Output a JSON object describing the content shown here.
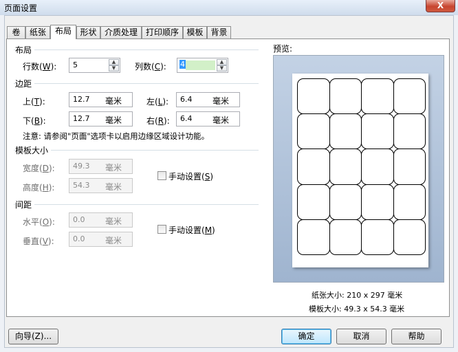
{
  "window": {
    "title": "页面设置",
    "close_label": "X"
  },
  "tabs": [
    "卷",
    "纸张",
    "布局",
    "形状",
    "介质处理",
    "打印顺序",
    "模板",
    "背景"
  ],
  "active_tab": "布局",
  "layout_section": {
    "title": "布局",
    "rows_label": "行数(",
    "rows_key": "W",
    "rows_close": "):",
    "rows_value": "5",
    "cols_label": "列数(",
    "cols_key": "C",
    "cols_close": "):",
    "cols_value": "4"
  },
  "margins_section": {
    "title": "边距",
    "top_label": "上(",
    "top_key": "T",
    "top_close": "):",
    "top_value": "12.7",
    "bottom_label": "下(",
    "bottom_key": "B",
    "bottom_close": "):",
    "bottom_value": "12.7",
    "left_label": "左(",
    "left_key": "L",
    "left_close": "):",
    "left_value": "6.4",
    "right_label": "右(",
    "right_key": "R",
    "right_close": "):",
    "right_value": "6.4",
    "unit": "毫米",
    "note": "注意: 请参阅\"页面\"选项卡以启用边缘区域设计功能。"
  },
  "template_size_section": {
    "title": "模板大小",
    "width_label": "宽度(",
    "width_key": "D",
    "width_close": "):",
    "width_value": "49.3",
    "height_label": "高度(",
    "height_key": "H",
    "height_close": "):",
    "height_value": "54.3",
    "unit": "毫米",
    "manual_label": "手动设置(",
    "manual_key": "S",
    "manual_close": ")"
  },
  "spacing_section": {
    "title": "间距",
    "horizontal_label": "水平(",
    "horizontal_key": "O",
    "horizontal_close": "):",
    "horizontal_value": "0.0",
    "vertical_label": "垂直(",
    "vertical_key": "V",
    "vertical_close": "):",
    "vertical_value": "0.0",
    "unit": "毫米",
    "manual_label": "手动设置(",
    "manual_key": "M",
    "manual_close": ")"
  },
  "preview": {
    "title": "预览:",
    "rows": 5,
    "cols": 4,
    "paper_size_text": "纸张大小: 210 x 297 毫米",
    "template_size_text": "模板大小: 49.3 x 54.3 毫米"
  },
  "buttons": {
    "wizard": "向导(Z)...",
    "ok": "确定",
    "cancel": "取消",
    "help": "帮助"
  }
}
